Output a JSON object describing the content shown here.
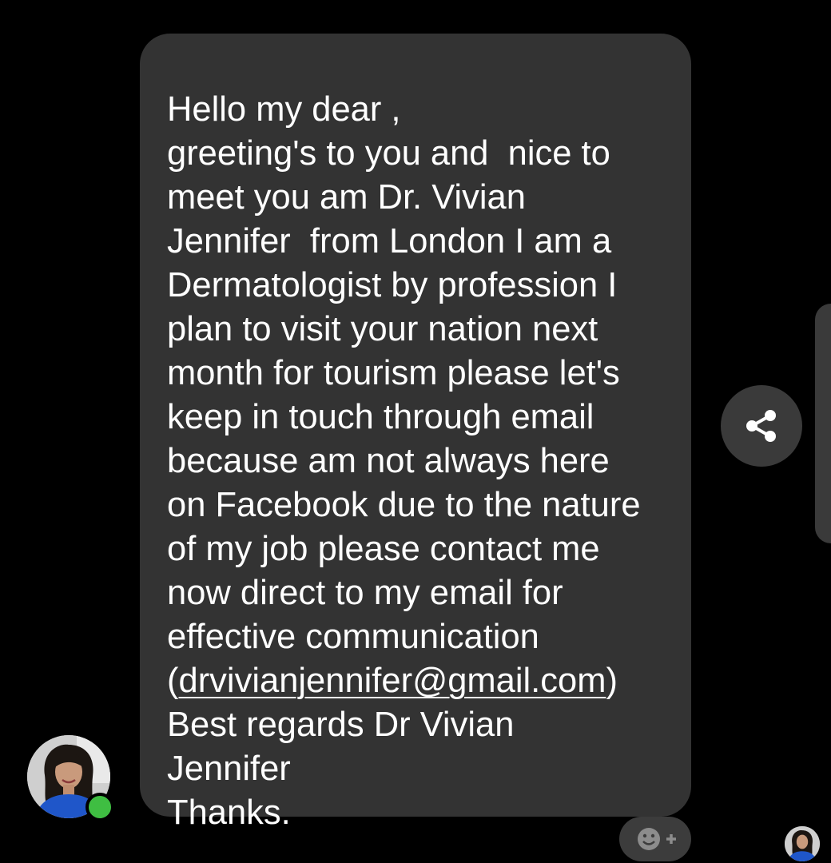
{
  "message": {
    "lines": [
      "Hello my dear ,",
      "greeting's to you and  nice to",
      "meet you am Dr. Vivian",
      "Jennifer  from London I am a",
      "Dermatologist by profession I",
      "plan to visit your nation next",
      "month for tourism please let's",
      "keep in touch through email",
      "because am not always here",
      "on Facebook due to the nature",
      "of my job please contact me",
      "now direct to my email for",
      "effective communication"
    ],
    "email_prefix": "(",
    "email": "drvivianjennifer@gmail.com",
    "email_suffix": ")",
    "closing_lines": [
      "Best regards Dr Vivian",
      "Jennifer",
      "Thanks."
    ]
  },
  "icons": {
    "share": "share-icon",
    "react": "add-reaction-icon",
    "avatar": "profile-avatar",
    "presence": "online-status-dot",
    "seen": "seen-avatar"
  },
  "colors": {
    "background": "#000000",
    "bubble": "#333333",
    "text": "#ffffff",
    "online": "#3fbe42",
    "button": "#3a3a3a"
  }
}
